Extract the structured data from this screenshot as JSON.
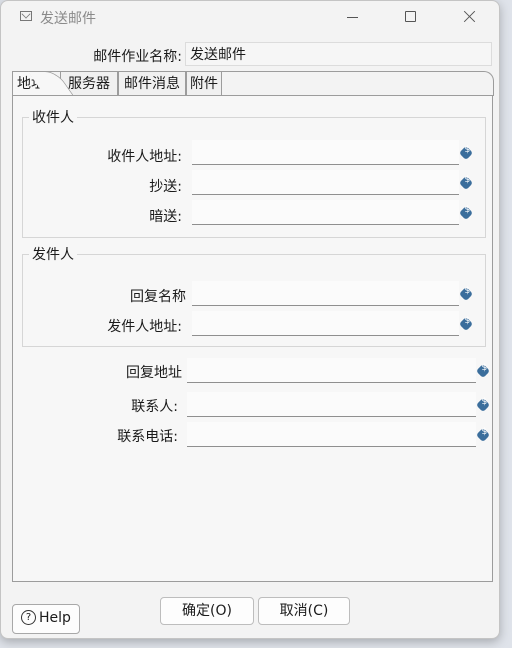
{
  "window": {
    "title": "发送邮件"
  },
  "job": {
    "label": "邮件作业名称:",
    "value": "发送邮件"
  },
  "tabs": [
    "地址",
    "服务器",
    "邮件消息",
    "附件"
  ],
  "recipient_group": {
    "legend": "收件人",
    "fields": [
      {
        "label": "收件人地址:",
        "value": ""
      },
      {
        "label": "抄送:",
        "value": ""
      },
      {
        "label": "暗送:",
        "value": ""
      }
    ]
  },
  "sender_group": {
    "legend": "发件人",
    "fields": [
      {
        "label": "回复名称",
        "value": ""
      },
      {
        "label": "发件人地址:",
        "value": ""
      }
    ]
  },
  "other_fields": [
    {
      "label": "回复地址",
      "value": ""
    },
    {
      "label": "联系人:",
      "value": ""
    },
    {
      "label": "联系电话:",
      "value": ""
    }
  ],
  "buttons": {
    "help": "Help",
    "help_icon": "?",
    "ok": "确定(O)",
    "cancel": "取消(C)"
  },
  "icons": {
    "variable": "variable-dollar-icon",
    "window": "mail-icon"
  },
  "colors": {
    "variable_icon": "#3b6e9c"
  }
}
